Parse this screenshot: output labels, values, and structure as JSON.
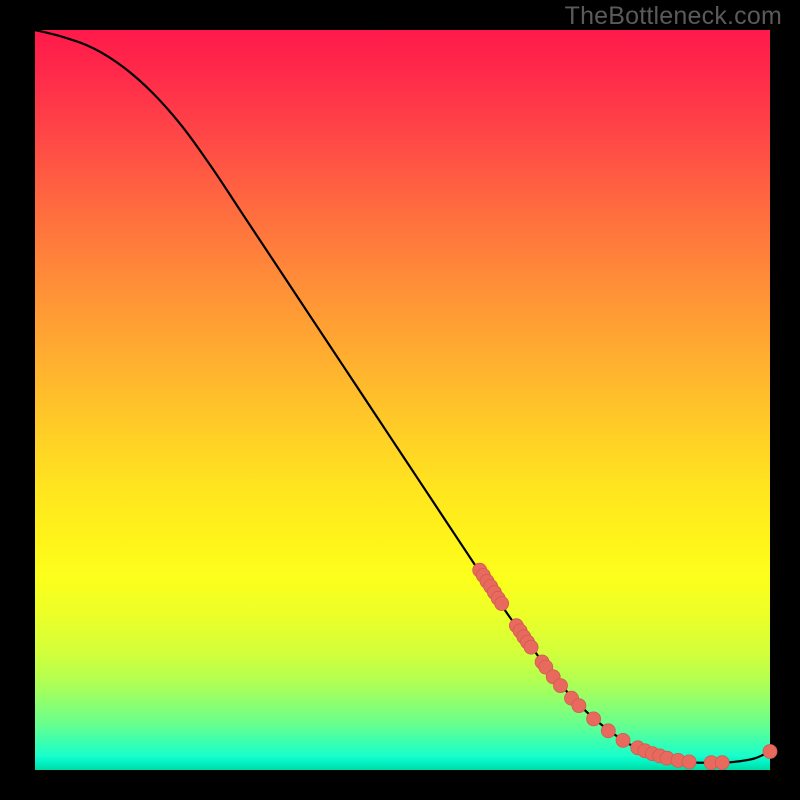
{
  "watermark": "TheBottleneck.com",
  "colors": {
    "line": "#000000",
    "marker_fill": "#e86a5e",
    "marker_stroke": "#d25a50",
    "background_black": "#000000"
  },
  "chart_data": {
    "type": "line",
    "title": "",
    "xlabel": "",
    "ylabel": "",
    "xlim": [
      0,
      100
    ],
    "ylim": [
      0,
      100
    ],
    "grid": false,
    "legend": false,
    "series": [
      {
        "name": "curve",
        "x": [
          0,
          4,
          8,
          12,
          16,
          20,
          24,
          28,
          32,
          36,
          40,
          44,
          48,
          52,
          56,
          60,
          64,
          68,
          72,
          76,
          80,
          82,
          84,
          86,
          88,
          90,
          92,
          94,
          96,
          98,
          100
        ],
        "y": [
          100,
          99,
          97.5,
          95,
          91.5,
          87,
          81.5,
          75.5,
          69.5,
          63.5,
          57.5,
          51.5,
          45.5,
          39.5,
          33.5,
          27.5,
          21.5,
          16,
          11,
          7,
          4,
          3,
          2.2,
          1.6,
          1.2,
          1.0,
          1.0,
          1.0,
          1.2,
          1.6,
          2.5
        ]
      }
    ],
    "markers": [
      {
        "x": 60.5,
        "y": 27.0
      },
      {
        "x": 61.0,
        "y": 26.3
      },
      {
        "x": 61.5,
        "y": 25.5
      },
      {
        "x": 62.0,
        "y": 24.8
      },
      {
        "x": 62.5,
        "y": 24.0
      },
      {
        "x": 63.0,
        "y": 23.2
      },
      {
        "x": 63.5,
        "y": 22.5
      },
      {
        "x": 65.5,
        "y": 19.5
      },
      {
        "x": 66.0,
        "y": 18.8
      },
      {
        "x": 66.5,
        "y": 18.0
      },
      {
        "x": 67.0,
        "y": 17.3
      },
      {
        "x": 67.5,
        "y": 16.6
      },
      {
        "x": 69.0,
        "y": 14.6
      },
      {
        "x": 69.5,
        "y": 13.9
      },
      {
        "x": 70.5,
        "y": 12.6
      },
      {
        "x": 71.5,
        "y": 11.4
      },
      {
        "x": 73.0,
        "y": 9.7
      },
      {
        "x": 74.0,
        "y": 8.7
      },
      {
        "x": 76.0,
        "y": 6.9
      },
      {
        "x": 78.0,
        "y": 5.3
      },
      {
        "x": 80.0,
        "y": 4.0
      },
      {
        "x": 82.0,
        "y": 3.0
      },
      {
        "x": 83.0,
        "y": 2.6
      },
      {
        "x": 84.0,
        "y": 2.2
      },
      {
        "x": 85.0,
        "y": 1.9
      },
      {
        "x": 86.0,
        "y": 1.6
      },
      {
        "x": 87.5,
        "y": 1.3
      },
      {
        "x": 89.0,
        "y": 1.1
      },
      {
        "x": 92.0,
        "y": 1.0
      },
      {
        "x": 93.5,
        "y": 1.0
      },
      {
        "x": 100.0,
        "y": 2.5
      }
    ]
  }
}
